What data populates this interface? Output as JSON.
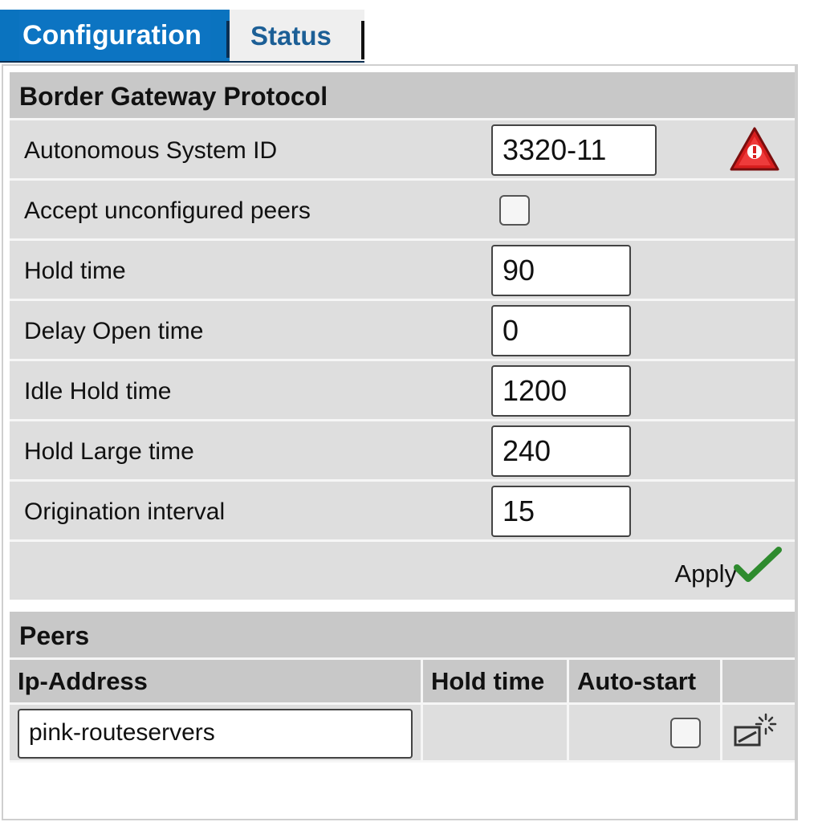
{
  "tabs": {
    "configuration": "Configuration",
    "status": "Status"
  },
  "bgp": {
    "title": "Border Gateway Protocol",
    "fields": [
      {
        "label": "Autonomous System ID",
        "value": "3320-11"
      },
      {
        "label": "Accept unconfigured peers",
        "checked": false
      },
      {
        "label": "Hold time",
        "value": "90"
      },
      {
        "label": "Delay Open time",
        "value": "0"
      },
      {
        "label": "Idle Hold time",
        "value": "1200"
      },
      {
        "label": "Hold Large time",
        "value": "240"
      },
      {
        "label": "Origination interval",
        "value": "15"
      }
    ],
    "apply_label": "Apply"
  },
  "peers": {
    "title": "Peers",
    "columns": [
      "Ip-Address",
      "Hold time",
      "Auto-start"
    ],
    "rows": [
      {
        "ip": "pink-routeservers",
        "hold_time": "",
        "auto_start": false
      }
    ]
  },
  "colors": {
    "tab_active": "#0c74c2",
    "tab_inactive_text": "#1c5f96",
    "warning_red": "#d81e1e",
    "apply_green": "#2e8b2e"
  },
  "icons": {
    "warning": "warning-triangle-icon",
    "apply": "checkmark-icon",
    "edit": "edit-peer-icon"
  }
}
